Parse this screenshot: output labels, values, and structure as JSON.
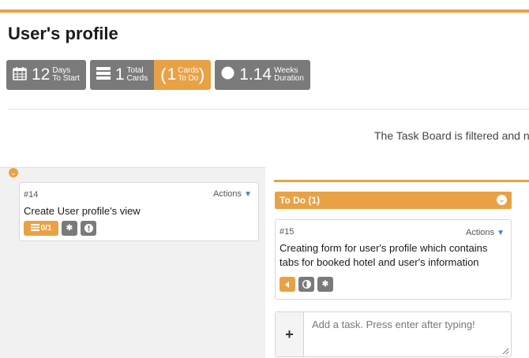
{
  "page": {
    "title": "User's profile"
  },
  "stats": {
    "days": {
      "value": "12",
      "label_top": "Days",
      "label_bottom": "To Start"
    },
    "total": {
      "value": "1",
      "label_top": "Total",
      "label_bottom": "Cards"
    },
    "todo": {
      "open": "(",
      "value": "1",
      "label_top": "Cards",
      "label_bottom": "To Do",
      "close": ")"
    },
    "weeks": {
      "value": "1.14",
      "label_top": "Weeks",
      "label_bottom": "Duration"
    }
  },
  "filter_notice": "The Task Board is filtered and n",
  "cards": [
    {
      "id": "#14",
      "actions": "Actions",
      "title": "Create User profile's view",
      "checklist": "0/1"
    },
    {
      "id": "#15",
      "actions": "Actions",
      "title": "Creating form for user's profile which contains tabs for booked hotel and user's information"
    }
  ],
  "lane": {
    "title": "To Do (1)"
  },
  "add_task": {
    "placeholder": "Add a task. Press enter after typing!",
    "plus": "+"
  },
  "icons": {
    "calendar": "calendar-icon",
    "cards": "cards-icon",
    "duration": "circle-icon",
    "checklist": "checklist-icon",
    "asterisk": "asterisk-icon",
    "info": "exclamation-icon",
    "back": "caret-left-icon",
    "half-circle": "half-circle-icon",
    "chevron": "chevron-down-icon"
  },
  "colors": {
    "accent": "#e8a245",
    "badge": "#7a7a7a",
    "link": "#3a87c9"
  }
}
